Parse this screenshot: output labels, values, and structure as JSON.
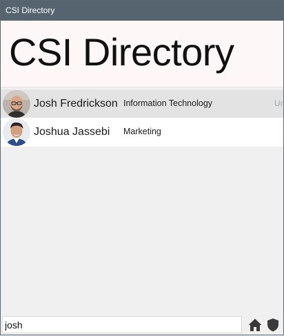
{
  "window": {
    "title": "CSI Directory"
  },
  "header": {
    "title": "CSI Directory"
  },
  "people": [
    {
      "name": "Josh Fredrickson",
      "department": "Information Technology",
      "extra": "Ur",
      "avatar_icon": "bald-man-avatar-icon"
    },
    {
      "name": "Joshua Jassebi",
      "department": "Marketing",
      "extra": "",
      "avatar_icon": "man-avatar-icon"
    }
  ],
  "search": {
    "value": "josh"
  },
  "toolbar": {
    "home_icon": "home-icon",
    "shield_icon": "shield-icon"
  },
  "colors": {
    "titlebar": "#56646f",
    "header_bg": "#fdf8f7",
    "selected_row": "#e3e3e3",
    "icon": "#3a3a3a"
  }
}
